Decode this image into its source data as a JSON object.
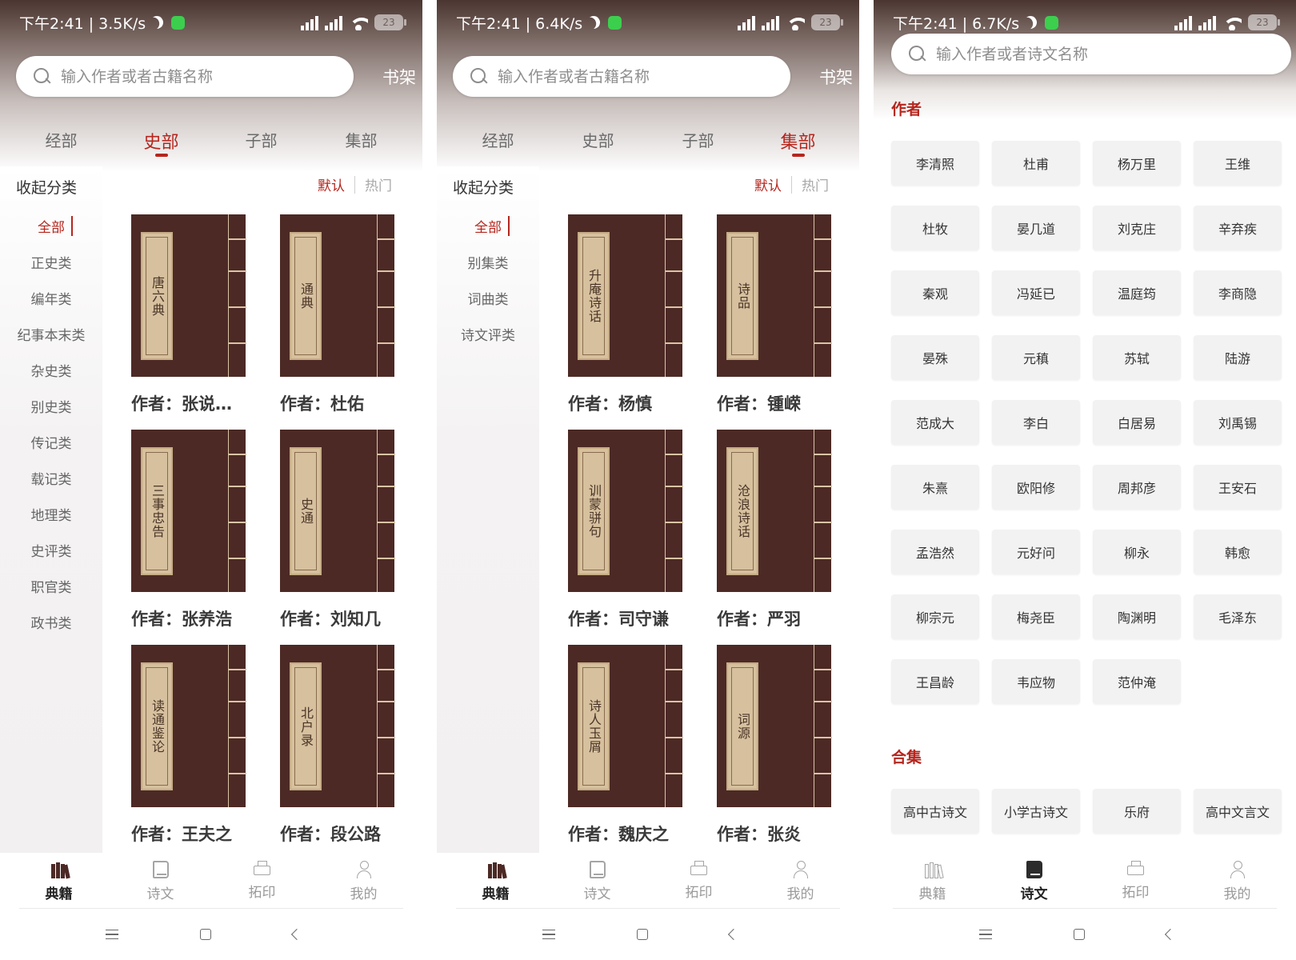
{
  "phone1": {
    "status": {
      "time_net": "下午2:41 | 3.5K/s",
      "battery": "23"
    },
    "search_placeholder": "输入作者或者古籍名称",
    "shelf": "书架",
    "tabs": [
      "经部",
      "史部",
      "子部",
      "集部"
    ],
    "active_tab": 1,
    "collapse": "收起分类",
    "sort": {
      "default": "默认",
      "hot": "热门"
    },
    "categories": [
      "全部",
      "正史类",
      "编年类",
      "纪事本末类",
      "杂史类",
      "别史类",
      "传记类",
      "载记类",
      "地理类",
      "史评类",
      "职官类",
      "政书类"
    ],
    "books": [
      {
        "title": "唐六典",
        "author": "作者：张说…"
      },
      {
        "title": "通典",
        "author": "作者：杜佑"
      },
      {
        "title": "三事忠告",
        "author": "作者：张养浩"
      },
      {
        "title": "史通",
        "author": "作者：刘知几"
      },
      {
        "title": "读通鉴论",
        "author": "作者：王夫之"
      },
      {
        "title": "北户录",
        "author": "作者：段公路"
      }
    ]
  },
  "phone2": {
    "status": {
      "time_net": "下午2:41 | 6.4K/s",
      "battery": "23"
    },
    "search_placeholder": "输入作者或者古籍名称",
    "shelf": "书架",
    "tabs": [
      "经部",
      "史部",
      "子部",
      "集部"
    ],
    "active_tab": 3,
    "collapse": "收起分类",
    "sort": {
      "default": "默认",
      "hot": "热门"
    },
    "categories": [
      "全部",
      "别集类",
      "词曲类",
      "诗文评类"
    ],
    "books": [
      {
        "title": "升庵诗话",
        "author": "作者：杨慎"
      },
      {
        "title": "诗品",
        "author": "作者：锺嵘"
      },
      {
        "title": "训蒙骈句",
        "author": "作者：司守谦"
      },
      {
        "title": "沧浪诗话",
        "author": "作者：严羽"
      },
      {
        "title": "诗人玉屑",
        "author": "作者：魏庆之"
      },
      {
        "title": "词源",
        "author": "作者：张炎"
      }
    ]
  },
  "phone3": {
    "status": {
      "time_net": "下午2:41 | 6.7K/s",
      "battery": "23"
    },
    "search_placeholder": "输入作者或者诗文名称",
    "authors_title": "作者",
    "authors": [
      "李清照",
      "杜甫",
      "杨万里",
      "王维",
      "杜牧",
      "晏几道",
      "刘克庄",
      "辛弃疾",
      "秦观",
      "冯延已",
      "温庭筠",
      "李商隐",
      "晏殊",
      "元稹",
      "苏轼",
      "陆游",
      "范成大",
      "李白",
      "白居易",
      "刘禹锡",
      "朱熹",
      "欧阳修",
      "周邦彦",
      "王安石",
      "孟浩然",
      "元好问",
      "柳永",
      "韩愈",
      "柳宗元",
      "梅尧臣",
      "陶渊明",
      "毛泽东",
      "王昌龄",
      "韦应物",
      "范仲淹"
    ],
    "collections_title": "合集",
    "collections": [
      "高中古诗文",
      "小学古诗文",
      "乐府",
      "高中文言文"
    ]
  },
  "bottom_nav": [
    "典籍",
    "诗文",
    "拓印",
    "我的"
  ],
  "bottom_nav_icons": [
    "books-icon",
    "book-icon",
    "printer-icon",
    "user-icon"
  ],
  "colors": {
    "accent": "#b5261e",
    "cover": "#4c2925",
    "label": "#d6c09e"
  }
}
